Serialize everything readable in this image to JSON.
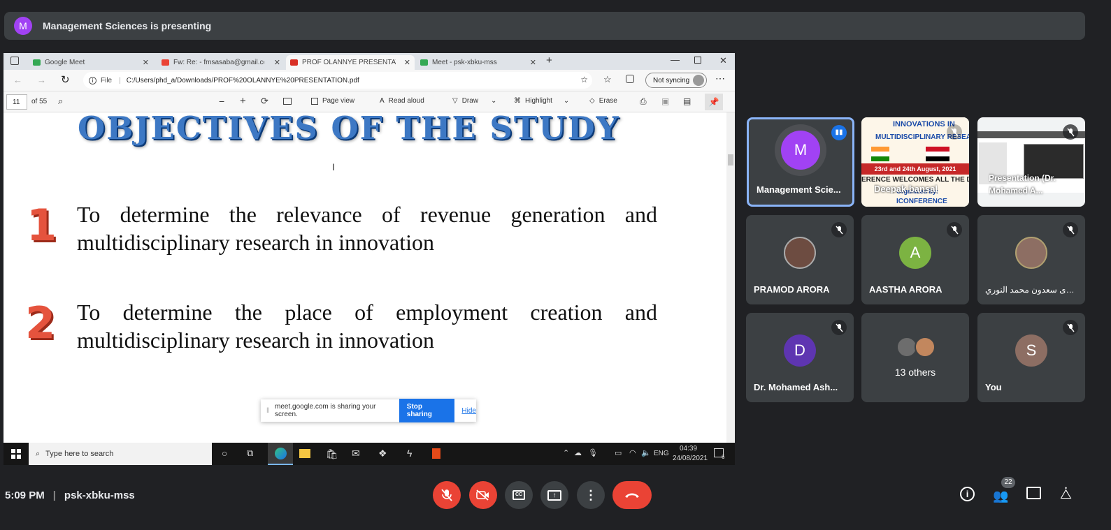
{
  "presentation_bar": {
    "avatar_letter": "M",
    "text": "Management Sciences is presenting"
  },
  "browser": {
    "tabs": [
      {
        "label": "Google Meet",
        "color": "#34a853"
      },
      {
        "label": "Fw: Re: - fmsasaba@gmail.com -",
        "color": "#ea4335"
      },
      {
        "label": "PROF OLANNYE PRESENTATION",
        "color": "#d93025"
      },
      {
        "label": "Meet - psk-xbku-mss",
        "color": "#34a853"
      }
    ],
    "file_label": "File",
    "url": "C:/Users/phd_a/Downloads/PROF%20OLANNYE%20PRESENTATION.pdf",
    "sync_label": "Not syncing"
  },
  "pdf_toolbar": {
    "page_number": "11",
    "page_total": "of 55",
    "page_view": "Page view",
    "read_aloud": "Read aloud",
    "draw": "Draw",
    "highlight": "Highlight",
    "erase": "Erase"
  },
  "slide": {
    "title": "OBJECTIVES OF THE STUDY",
    "objectives": [
      {
        "num": "1",
        "text": "To determine the relevance of revenue generation and multidisciplinary research in innovation"
      },
      {
        "num": "2",
        "text": "To determine the place of employment creation  and multidisciplinary research in innovation"
      }
    ]
  },
  "share_toast": {
    "text": "meet.google.com is sharing your screen.",
    "stop": "Stop sharing",
    "hide": "Hide"
  },
  "taskbar": {
    "search_placeholder": "Type here to search",
    "lang": "ENG",
    "time": "04:39",
    "date": "24/08/2021",
    "notif_count": "6"
  },
  "participants": [
    {
      "name": "Management Scie...",
      "letter": "M",
      "color": "#a142f4",
      "speaking": true
    },
    {
      "name": "Deepak bansal",
      "letter": "",
      "color": "",
      "image_lines": [
        "INNOVATIONS IN",
        "MULTIDISCIPLINARY RESEA",
        "23rd and 24th August, 2021",
        "ERENCE WELCOMES ALL THE DEL",
        "Organized by:",
        "ICONFERENCE"
      ]
    },
    {
      "name": "Presentation (Dr. Mohamed A...",
      "letter": "",
      "color": ""
    },
    {
      "name": "PRAMOD ARORA",
      "letter": "",
      "color": "#6d4c41"
    },
    {
      "name": "AASTHA ARORA",
      "letter": "A",
      "color": "#7cb342"
    },
    {
      "name": "بشرى سعدون محمد النوري",
      "letter": "",
      "color": "#8d6e63"
    },
    {
      "name": "Dr. Mohamed Ash...",
      "letter": "D",
      "color": "#5e35b1"
    },
    {
      "name": "13 others",
      "letter": "",
      "color": ""
    },
    {
      "name": "You",
      "letter": "S",
      "color": "#8d6e63"
    }
  ],
  "bottom_bar": {
    "time": "5:09 PM",
    "meeting_code": "psk-xbku-mss",
    "people_count": "22"
  }
}
